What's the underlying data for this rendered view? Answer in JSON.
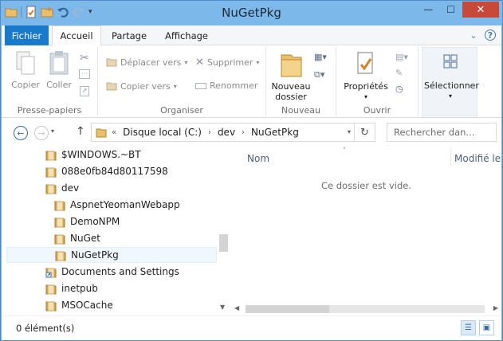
{
  "window": {
    "title": "NuGetPkg",
    "controls": {
      "minimize": "—",
      "maximize": "☐",
      "close": "✕"
    }
  },
  "tabs": [
    {
      "label": "Fichier"
    },
    {
      "label": "Accueil"
    },
    {
      "label": "Partage"
    },
    {
      "label": "Affichage"
    }
  ],
  "ribbon": {
    "clipboard": {
      "copy": "Copier",
      "paste": "Coller",
      "group": "Presse-papiers"
    },
    "organize": {
      "move_to": "Déplacer vers",
      "copy_to": "Copier vers",
      "delete": "Supprimer",
      "rename": "Renommer",
      "group": "Organiser"
    },
    "new": {
      "new_folder_line1": "Nouveau",
      "new_folder_line2": "dossier",
      "group": "Nouveau"
    },
    "open": {
      "properties": "Propriétés",
      "group": "Ouvrir"
    },
    "select": {
      "select": "Sélectionner"
    }
  },
  "address": {
    "prefix": "«",
    "segments": [
      "Disque local (C:)",
      "dev",
      "NuGetPkg"
    ]
  },
  "search": {
    "placeholder": "Rechercher dan..."
  },
  "tree": [
    {
      "label": "$WINDOWS.~BT",
      "level": 0
    },
    {
      "label": "088e0fb84d80117598",
      "level": 0
    },
    {
      "label": "dev",
      "level": 0
    },
    {
      "label": "AspnetYeomanWebapp",
      "level": 1
    },
    {
      "label": "DemoNPM",
      "level": 1
    },
    {
      "label": "NuGet",
      "level": 1
    },
    {
      "label": "NuGetPkg",
      "level": 1,
      "selected": true
    },
    {
      "label": "Documents and Settings",
      "level": 0,
      "shortcut": true
    },
    {
      "label": "inetpub",
      "level": 0
    },
    {
      "label": "MSOCache",
      "level": 0
    }
  ],
  "list": {
    "columns": {
      "name": "Nom",
      "modified": "Modifié le"
    },
    "empty_message": "Ce dossier est vide."
  },
  "status": {
    "count": "0 élément(s)"
  },
  "colors": {
    "accent": "#1979ca",
    "titlebar": "#7cb8ea",
    "close": "#c7493a",
    "folder": "#dba94f"
  }
}
